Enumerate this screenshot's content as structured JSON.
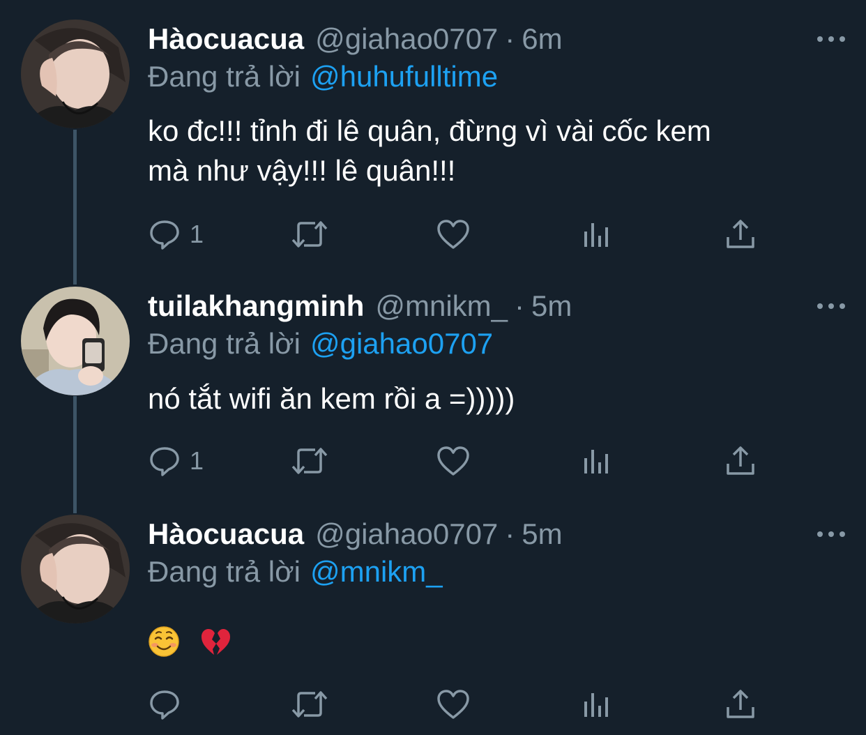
{
  "tweets": [
    {
      "display_name": "Hàocuacua",
      "handle": "@giahao0707",
      "separator": "·",
      "time": "6m",
      "reply_prefix": "Đang trả lời",
      "reply_to": "@huhufulltime",
      "text_lines": [
        "ko đc!!! tỉnh đi lê quân, đừng vì vài cốc kem",
        "mà như vậy!!! lê quân!!!"
      ],
      "reply_count": "1"
    },
    {
      "display_name": "tuilakhangminh",
      "handle": "@mnikm_",
      "separator": "·",
      "time": "5m",
      "reply_prefix": "Đang trả lời",
      "reply_to": "@giahao0707",
      "text_lines": [
        "nó tắt wifi ăn kem rồi a =)))))"
      ],
      "reply_count": "1"
    },
    {
      "display_name": "Hàocuacua",
      "handle": "@giahao0707",
      "separator": "·",
      "time": "5m",
      "reply_prefix": "Đang trả lời",
      "reply_to": "@mnikm_",
      "emojis": [
        "smiling-face-emoji",
        "broken-heart-emoji"
      ],
      "reply_count": ""
    }
  ],
  "colors": {
    "background": "#15202b",
    "muted": "#8899a6",
    "link": "#1da1f2",
    "thread_line": "#3d5466"
  }
}
